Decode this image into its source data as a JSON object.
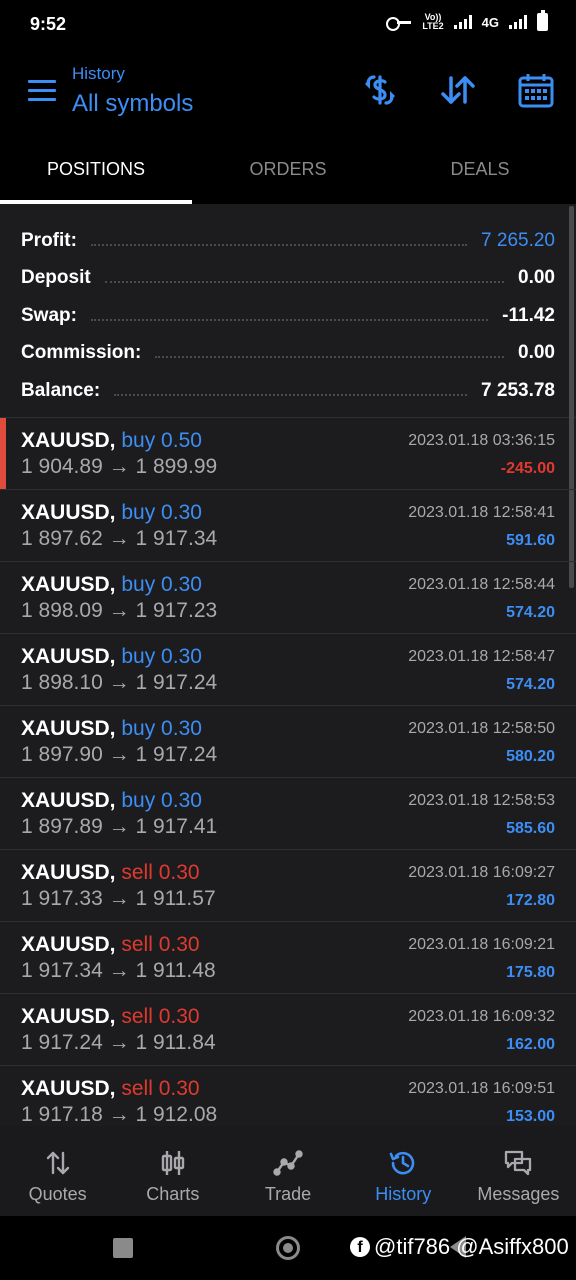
{
  "status_bar": {
    "time": "9:52",
    "volte_line1": "Vo))",
    "volte_line2": "LTE2",
    "network": "4G"
  },
  "header": {
    "subtitle": "History",
    "title": "All symbols",
    "icons": [
      "menu-icon",
      "currency-exchange-icon",
      "sort-icon",
      "calendar-icon"
    ]
  },
  "tabs": [
    {
      "label": "POSITIONS",
      "active": true
    },
    {
      "label": "ORDERS",
      "active": false
    },
    {
      "label": "DEALS",
      "active": false
    }
  ],
  "summary": [
    {
      "label": "Profit:",
      "value": "7 265.20",
      "highlight": true
    },
    {
      "label": "Deposit",
      "value": "0.00",
      "highlight": false
    },
    {
      "label": "Swap:",
      "value": "-11.42",
      "highlight": false
    },
    {
      "label": "Commission:",
      "value": "0.00",
      "highlight": false
    },
    {
      "label": "Balance:",
      "value": "7 253.78",
      "highlight": false
    }
  ],
  "deals": [
    {
      "symbol": "XAUUSD,",
      "side": "buy 0.50",
      "type": "buy",
      "open": "1 904.89",
      "close": "1 899.99",
      "arrow": "→",
      "time": "2023.01.18 03:36:15",
      "profit": "-245.00",
      "negative": true
    },
    {
      "symbol": "XAUUSD,",
      "side": "buy 0.30",
      "type": "buy",
      "open": "1 897.62",
      "close": "1 917.34",
      "arrow": "→",
      "time": "2023.01.18 12:58:41",
      "profit": "591.60",
      "negative": false
    },
    {
      "symbol": "XAUUSD,",
      "side": "buy 0.30",
      "type": "buy",
      "open": "1 898.09",
      "close": "1 917.23",
      "arrow": "→",
      "time": "2023.01.18 12:58:44",
      "profit": "574.20",
      "negative": false
    },
    {
      "symbol": "XAUUSD,",
      "side": "buy 0.30",
      "type": "buy",
      "open": "1 898.10",
      "close": "1 917.24",
      "arrow": "→",
      "time": "2023.01.18 12:58:47",
      "profit": "574.20",
      "negative": false
    },
    {
      "symbol": "XAUUSD,",
      "side": "buy 0.30",
      "type": "buy",
      "open": "1 897.90",
      "close": "1 917.24",
      "arrow": "→",
      "time": "2023.01.18 12:58:50",
      "profit": "580.20",
      "negative": false
    },
    {
      "symbol": "XAUUSD,",
      "side": "buy 0.30",
      "type": "buy",
      "open": "1 897.89",
      "close": "1 917.41",
      "arrow": "→",
      "time": "2023.01.18 12:58:53",
      "profit": "585.60",
      "negative": false
    },
    {
      "symbol": "XAUUSD,",
      "side": "sell 0.30",
      "type": "sell",
      "open": "1 917.33",
      "close": "1 911.57",
      "arrow": "→",
      "time": "2023.01.18 16:09:27",
      "profit": "172.80",
      "negative": false
    },
    {
      "symbol": "XAUUSD,",
      "side": "sell 0.30",
      "type": "sell",
      "open": "1 917.34",
      "close": "1 911.48",
      "arrow": "→",
      "time": "2023.01.18 16:09:21",
      "profit": "175.80",
      "negative": false
    },
    {
      "symbol": "XAUUSD,",
      "side": "sell 0.30",
      "type": "sell",
      "open": "1 917.24",
      "close": "1 911.84",
      "arrow": "→",
      "time": "2023.01.18 16:09:32",
      "profit": "162.00",
      "negative": false
    },
    {
      "symbol": "XAUUSD,",
      "side": "sell 0.30",
      "type": "sell",
      "open": "1 917.18",
      "close": "1 912.08",
      "arrow": "→",
      "time": "2023.01.18 16:09:51",
      "profit": "153.00",
      "negative": false
    }
  ],
  "bottom_nav": [
    {
      "label": "Quotes",
      "icon": "quotes-icon",
      "active": false
    },
    {
      "label": "Charts",
      "icon": "charts-icon",
      "active": false
    },
    {
      "label": "Trade",
      "icon": "trade-icon",
      "active": false
    },
    {
      "label": "History",
      "icon": "history-icon",
      "active": true
    },
    {
      "label": "Messages",
      "icon": "messages-icon",
      "active": false
    }
  ],
  "watermark": {
    "fb_glyph": "f",
    "text": "@tif786 @Asiffx800"
  },
  "colors": {
    "accent": "#3c8ef5",
    "loss": "#e0392f",
    "selected_marker": "#e04c3c",
    "panel": "#1c1c1e"
  }
}
